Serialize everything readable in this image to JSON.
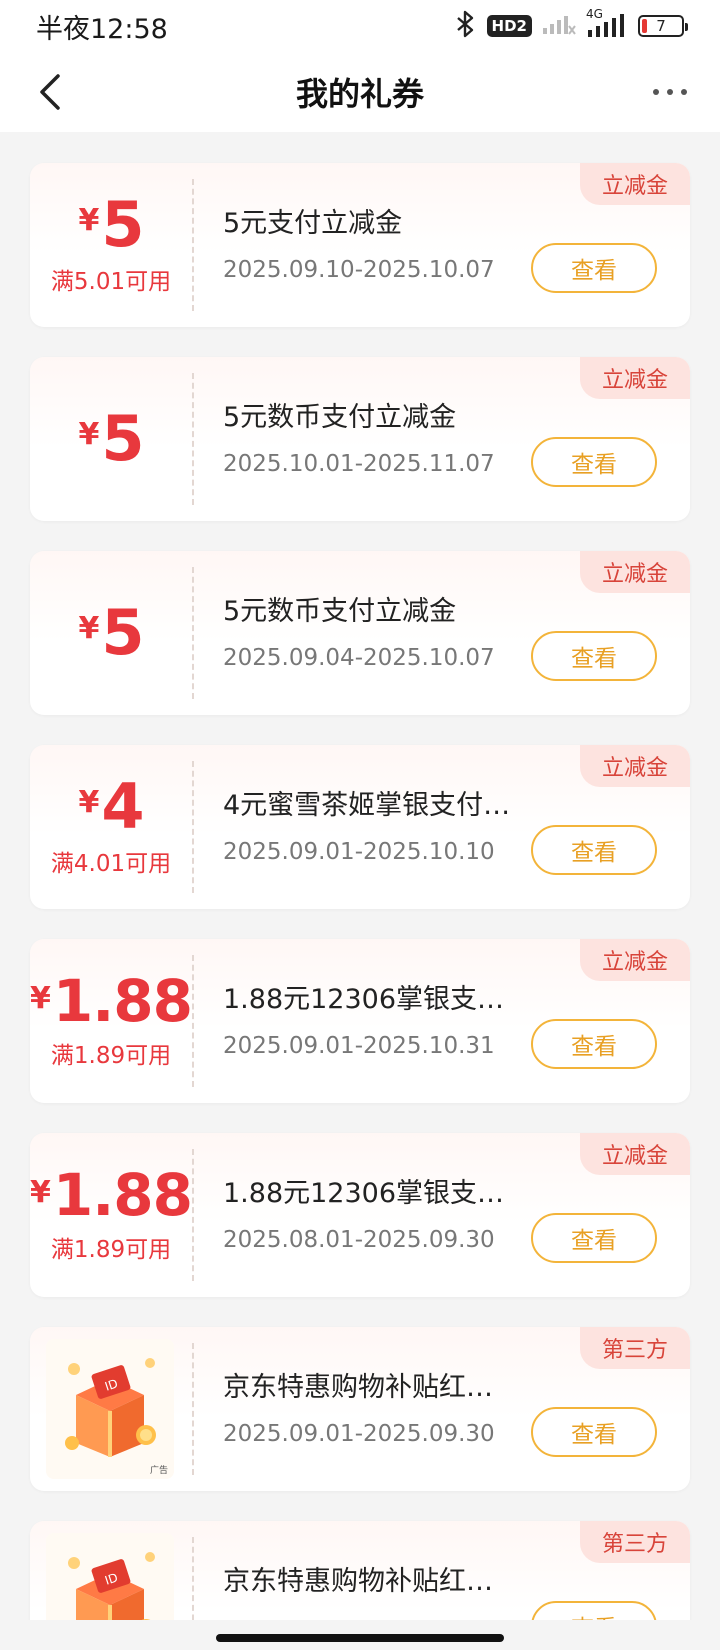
{
  "status": {
    "time": "半夜12:58",
    "hd_badge": "HD2",
    "network": "4G",
    "battery_level": "7"
  },
  "nav": {
    "title": "我的礼券"
  },
  "coupons": [
    {
      "currency": "¥",
      "amount": "5",
      "condition": "满5.01可用",
      "title": "5元支付立减金",
      "date": "2025.09.10-2025.10.07",
      "tag": "立减金",
      "button": "查看",
      "image": false
    },
    {
      "currency": "¥",
      "amount": "5",
      "condition": "",
      "title": "5元数币支付立减金",
      "date": "2025.10.01-2025.11.07",
      "tag": "立减金",
      "button": "查看",
      "image": false
    },
    {
      "currency": "¥",
      "amount": "5",
      "condition": "",
      "title": "5元数币支付立减金",
      "date": "2025.09.04-2025.10.07",
      "tag": "立减金",
      "button": "查看",
      "image": false
    },
    {
      "currency": "¥",
      "amount": "4",
      "condition": "满4.01可用",
      "title": "4元蜜雪茶姬掌银支付…",
      "date": "2025.09.01-2025.10.10",
      "tag": "立减金",
      "button": "查看",
      "image": false
    },
    {
      "currency": "¥",
      "amount": "1.88",
      "condition": "满1.89可用",
      "title": "1.88元12306掌银支…",
      "date": "2025.09.01-2025.10.31",
      "tag": "立减金",
      "button": "查看",
      "image": false
    },
    {
      "currency": "¥",
      "amount": "1.88",
      "condition": "满1.89可用",
      "title": "1.88元12306掌银支…",
      "date": "2025.08.01-2025.09.30",
      "tag": "立减金",
      "button": "查看",
      "image": false
    },
    {
      "currency": "",
      "amount": "",
      "condition": "",
      "title": "京东特惠购物补贴红…",
      "date": "2025.09.01-2025.09.30",
      "tag": "第三方",
      "button": "查看",
      "image": true,
      "image_label": "广告"
    },
    {
      "currency": "",
      "amount": "",
      "condition": "",
      "title": "京东特惠购物补贴红…",
      "date": "",
      "tag": "第三方",
      "button": "查看",
      "image": true,
      "image_label": ""
    }
  ],
  "colors": {
    "accent_red": "#e8383d",
    "button_orange": "#f3b43a",
    "tag_bg": "#fde3df"
  }
}
